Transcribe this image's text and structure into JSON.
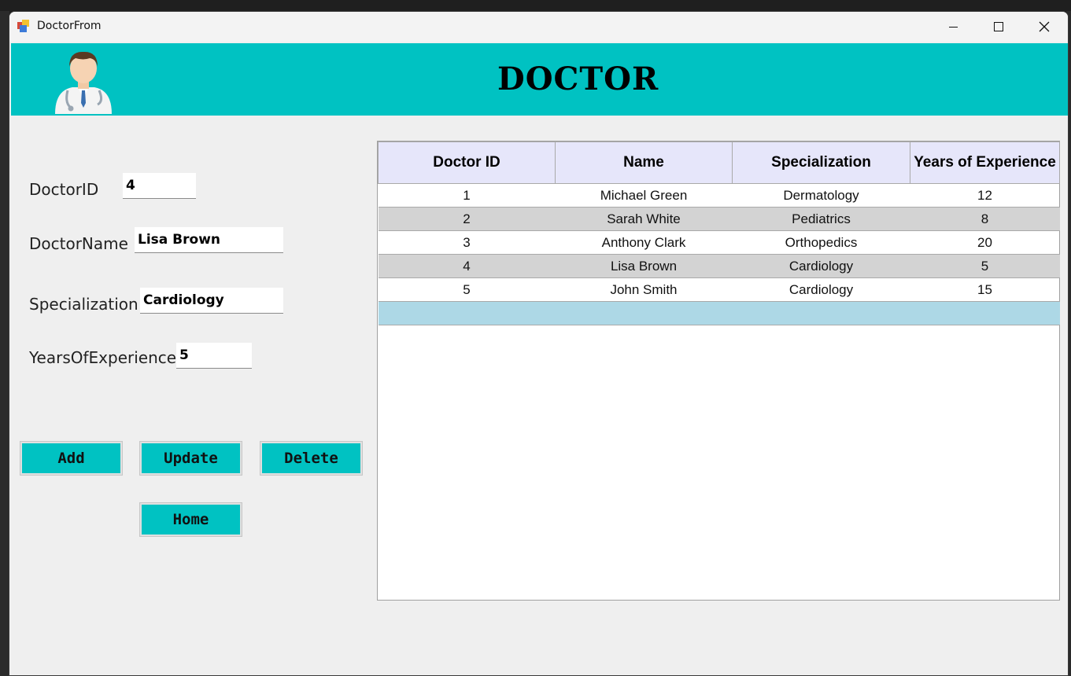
{
  "window": {
    "title": "DoctorFrom"
  },
  "header": {
    "title": "DOCTOR",
    "background": "#00c2c2"
  },
  "form": {
    "doctor_id": {
      "label": "DoctorID",
      "value": "4"
    },
    "doctor_name": {
      "label": "DoctorName",
      "value": "Lisa Brown"
    },
    "specialization": {
      "label": "Specialization",
      "value": "Cardiology"
    },
    "years": {
      "label": "YearsOfExperience",
      "value": "5"
    }
  },
  "buttons": {
    "add": "Add",
    "update": "Update",
    "delete": "Delete",
    "home": "Home"
  },
  "grid": {
    "columns": [
      "Doctor ID",
      "Name",
      "Specialization",
      "Years of Experience"
    ],
    "rows": [
      [
        "1",
        "Michael Green",
        "Dermatology",
        "12"
      ],
      [
        "2",
        "Sarah White",
        "Pediatrics",
        "8"
      ],
      [
        "3",
        "Anthony Clark",
        "Orthopedics",
        "20"
      ],
      [
        "4",
        "Lisa Brown",
        "Cardiology",
        "5"
      ],
      [
        "5",
        "John Smith",
        "Cardiology",
        "15"
      ]
    ]
  },
  "colors": {
    "accent": "#00c2c2",
    "header_row": "#e6e6fa",
    "alt_row": "#d3d3d3",
    "new_row": "#add8e6"
  }
}
